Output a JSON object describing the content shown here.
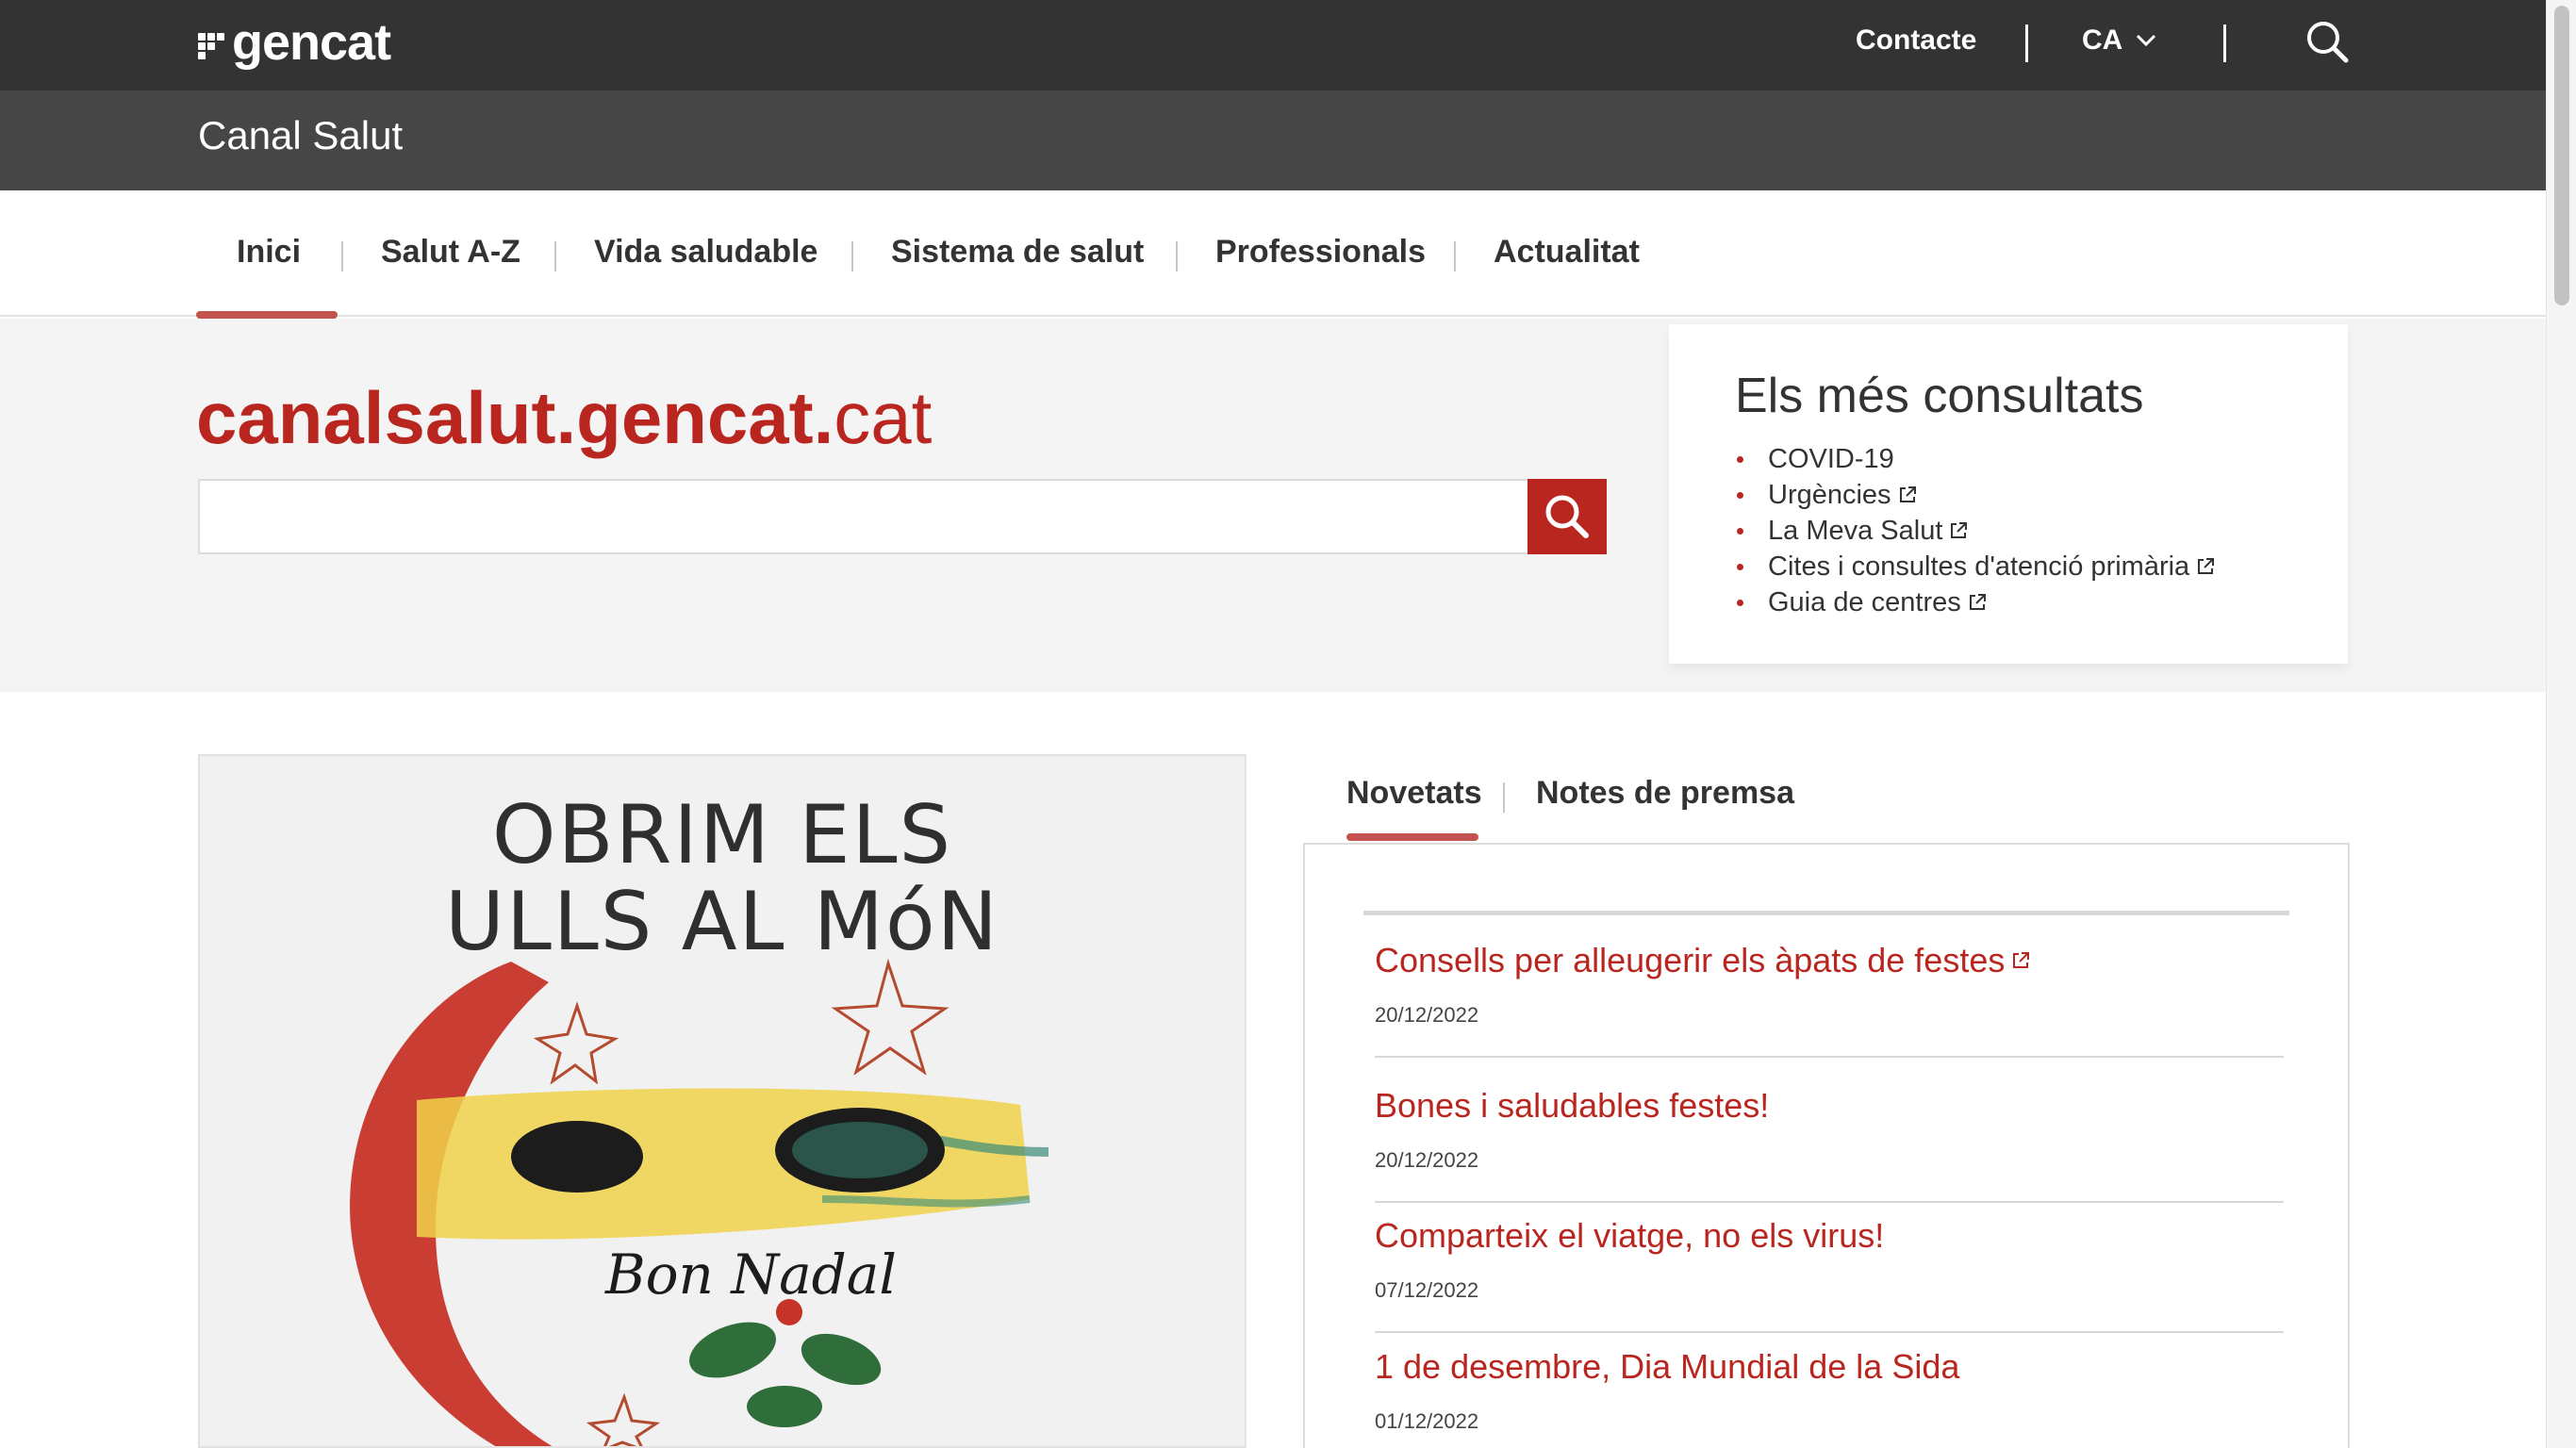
{
  "topbar": {
    "logo_text": "gencat",
    "contact_label": "Contacte",
    "language": "CA"
  },
  "site": {
    "title": "Canal Salut"
  },
  "nav": {
    "items": [
      {
        "label": "Inici",
        "active": true
      },
      {
        "label": "Salut A-Z"
      },
      {
        "label": "Vida saludable"
      },
      {
        "label": "Sistema de salut"
      },
      {
        "label": "Professionals"
      },
      {
        "label": "Actualitat"
      }
    ]
  },
  "hero": {
    "brand_bold": "canalsalut.gencat.",
    "brand_light": "cat",
    "search_value": "",
    "accent_color": "#b9261f"
  },
  "popular": {
    "title": "Els més consultats",
    "items": [
      {
        "label": "COVID-19",
        "external": false
      },
      {
        "label": "Urgències",
        "external": true
      },
      {
        "label": "La Meva Salut",
        "external": true
      },
      {
        "label": "Cites i consultes d'atenció primària",
        "external": true
      },
      {
        "label": "Guia de centres",
        "external": true
      }
    ]
  },
  "banner": {
    "line1": "OBRIM ELS",
    "line2": "ULLS AL MóN",
    "signature": "Bon Nadal"
  },
  "news": {
    "tabs": [
      {
        "label": "Novetats",
        "active": true
      },
      {
        "label": "Notes de premsa"
      }
    ],
    "items": [
      {
        "title": "Consells per alleugerir els àpats de festes",
        "date": "20/12/2022",
        "external": true
      },
      {
        "title": "Bones i saludables festes!",
        "date": "20/12/2022",
        "external": false
      },
      {
        "title": "Comparteix el viatge, no els virus!",
        "date": "07/12/2022",
        "external": false
      },
      {
        "title": "1 de desembre, Dia Mundial de la Sida",
        "date": "01/12/2022",
        "external": false
      }
    ]
  }
}
